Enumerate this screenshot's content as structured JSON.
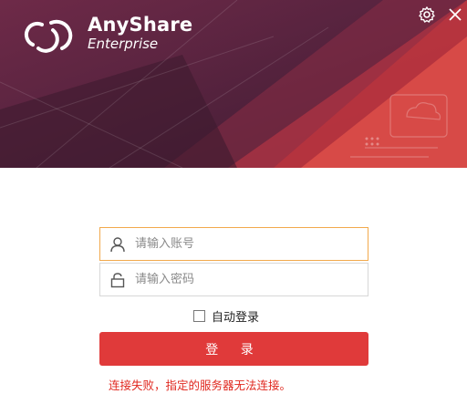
{
  "header": {
    "brand_title": "AnyShare",
    "brand_subtitle": "Enterprise",
    "settings_icon": "gear-icon",
    "close_icon": "close-icon"
  },
  "form": {
    "username": {
      "placeholder": "请输入账号",
      "value": "",
      "icon": "user-icon"
    },
    "password": {
      "placeholder": "请输入密码",
      "value": "",
      "icon": "lock-icon"
    },
    "auto_login": {
      "label": "自动登录",
      "checked": false
    },
    "login_button": "登 录",
    "error_message": "连接失败，指定的服务器无法连接。"
  },
  "colors": {
    "banner": "#5a2440",
    "accent": "#e03a3a",
    "error": "#e0281f",
    "focus_border": "#f2a94c"
  }
}
